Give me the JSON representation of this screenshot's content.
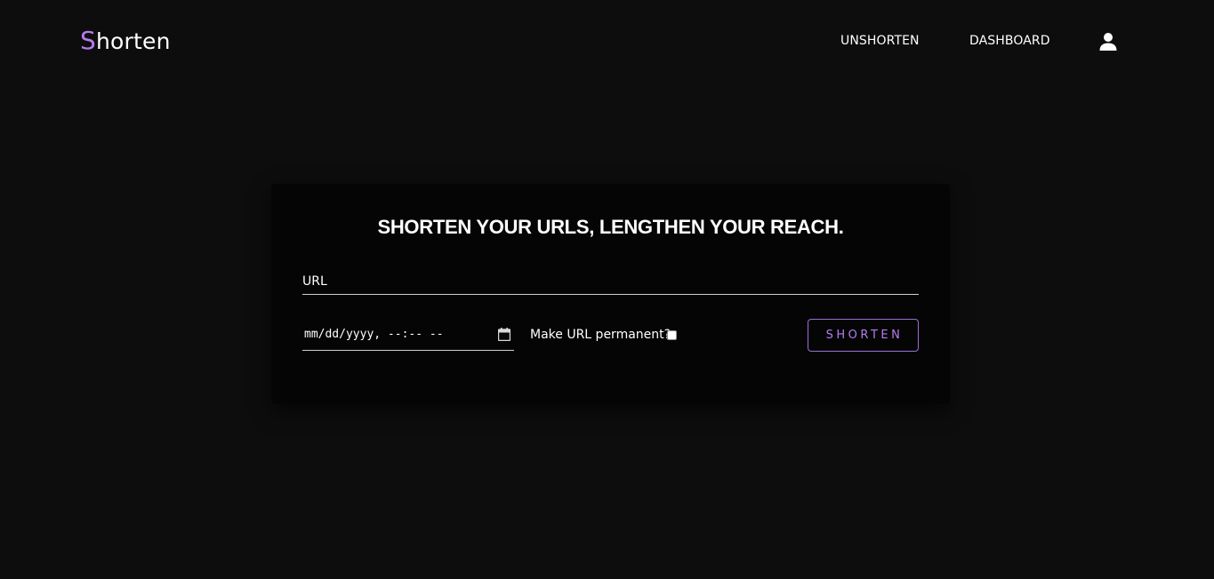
{
  "header": {
    "logo_initial": "S",
    "logo_rest": "horten",
    "nav": {
      "unshorten": "UNSHORTEN",
      "dashboard": "DASHBOARD"
    },
    "profile_icon": "user-icon"
  },
  "card": {
    "title": "SHORTEN YOUR URLS, LENGTHEN YOUR REACH.",
    "url_placeholder": "URL",
    "url_value": "",
    "expiry_placeholder": "mm/dd/yyyy, --:-- --",
    "expiry_icon": "calendar-icon",
    "permanent_label": "Make URL permanent?",
    "permanent_checked": false,
    "submit_label": "SHORTEN"
  },
  "colors": {
    "background": "#0d0d0d",
    "card": "#050505",
    "accent": "#b57cf0",
    "text": "#ffffff"
  }
}
